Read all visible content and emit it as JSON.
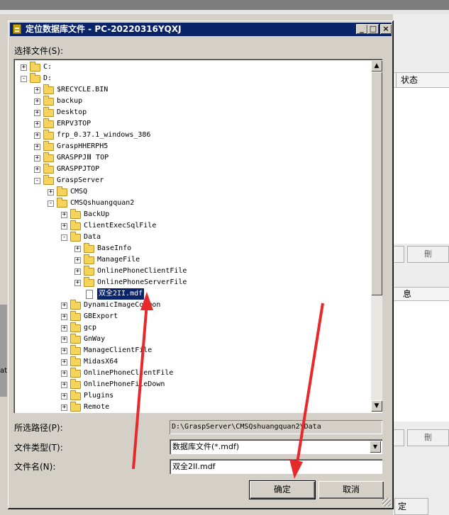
{
  "background": {
    "status_header": "状态",
    "panel_header": "息",
    "btn1": "刪",
    "btn2": "刪",
    "side_text": "at",
    "bottom_btn": "定"
  },
  "dialog": {
    "title": "定位数据库文件 - PC-20220316YQXJ",
    "choose_label": "选择文件(S):",
    "path_label": "所选路径(P):",
    "path_value": "D:\\GraspServer\\CMSQshuangquan2\\Data",
    "type_label": "文件类型(T):",
    "type_value": "数据库文件(*.mdf)",
    "name_label": "文件名(N):",
    "name_value": "双全2II.mdf",
    "ok": "确定",
    "cancel": "取消"
  },
  "tree": [
    {
      "label": "C:",
      "level": 0,
      "exp": "+"
    },
    {
      "label": "D:",
      "level": 0,
      "exp": "-"
    },
    {
      "label": "$RECYCLE.BIN",
      "level": 1,
      "exp": "+"
    },
    {
      "label": "backup",
      "level": 1,
      "exp": "+"
    },
    {
      "label": "Desktop",
      "level": 1,
      "exp": "+"
    },
    {
      "label": "ERPV3TOP",
      "level": 1,
      "exp": "+"
    },
    {
      "label": "frp_0.37.1_windows_386",
      "level": 1,
      "exp": "+"
    },
    {
      "label": "GraspHHERPH5",
      "level": 1,
      "exp": "+"
    },
    {
      "label": "GRASPPJⅢ TOP",
      "level": 1,
      "exp": "+"
    },
    {
      "label": "GRASPPJTOP",
      "level": 1,
      "exp": "+"
    },
    {
      "label": "GraspServer",
      "level": 1,
      "exp": "-"
    },
    {
      "label": "CMSQ",
      "level": 2,
      "exp": "+"
    },
    {
      "label": "CMSQshuangquan2",
      "level": 2,
      "exp": "-"
    },
    {
      "label": "BackUp",
      "level": 3,
      "exp": "+"
    },
    {
      "label": "ClientExecSqlFile",
      "level": 3,
      "exp": "+"
    },
    {
      "label": "Data",
      "level": 3,
      "exp": "-"
    },
    {
      "label": "BaseInfo",
      "level": 4,
      "exp": "+"
    },
    {
      "label": "ManageFile",
      "level": 4,
      "exp": "+"
    },
    {
      "label": "OnlinePhoneClientFile",
      "level": 4,
      "exp": "+"
    },
    {
      "label": "OnlinePhoneServerFile",
      "level": 4,
      "exp": "+"
    },
    {
      "label": "双全2II.mdf",
      "level": 4,
      "exp": "",
      "file": true,
      "selected": true
    },
    {
      "label": "DynamicImageCommon",
      "level": 3,
      "exp": "+"
    },
    {
      "label": "GBExport",
      "level": 3,
      "exp": "+"
    },
    {
      "label": "gcp",
      "level": 3,
      "exp": "+"
    },
    {
      "label": "GnWay",
      "level": 3,
      "exp": "+"
    },
    {
      "label": "ManageClientFile",
      "level": 3,
      "exp": "+"
    },
    {
      "label": "MidasX64",
      "level": 3,
      "exp": "+"
    },
    {
      "label": "OnlinePhoneClientFile",
      "level": 3,
      "exp": "+"
    },
    {
      "label": "OnlinePhoneFileDown",
      "level": 3,
      "exp": "+"
    },
    {
      "label": "Plugins",
      "level": 3,
      "exp": "+"
    },
    {
      "label": "Remote",
      "level": 3,
      "exp": "+"
    }
  ],
  "colors": {
    "titlebar": "#0a246a",
    "selection": "#0a246a",
    "folder": "#f6d45c",
    "annotation_arrow": "#e8292b"
  },
  "icons": [
    "app-icon",
    "minimize-icon",
    "maximize-icon",
    "close-icon",
    "folder-icon",
    "file-icon",
    "scroll-up-icon",
    "scroll-down-icon",
    "dropdown-arrow-icon"
  ]
}
